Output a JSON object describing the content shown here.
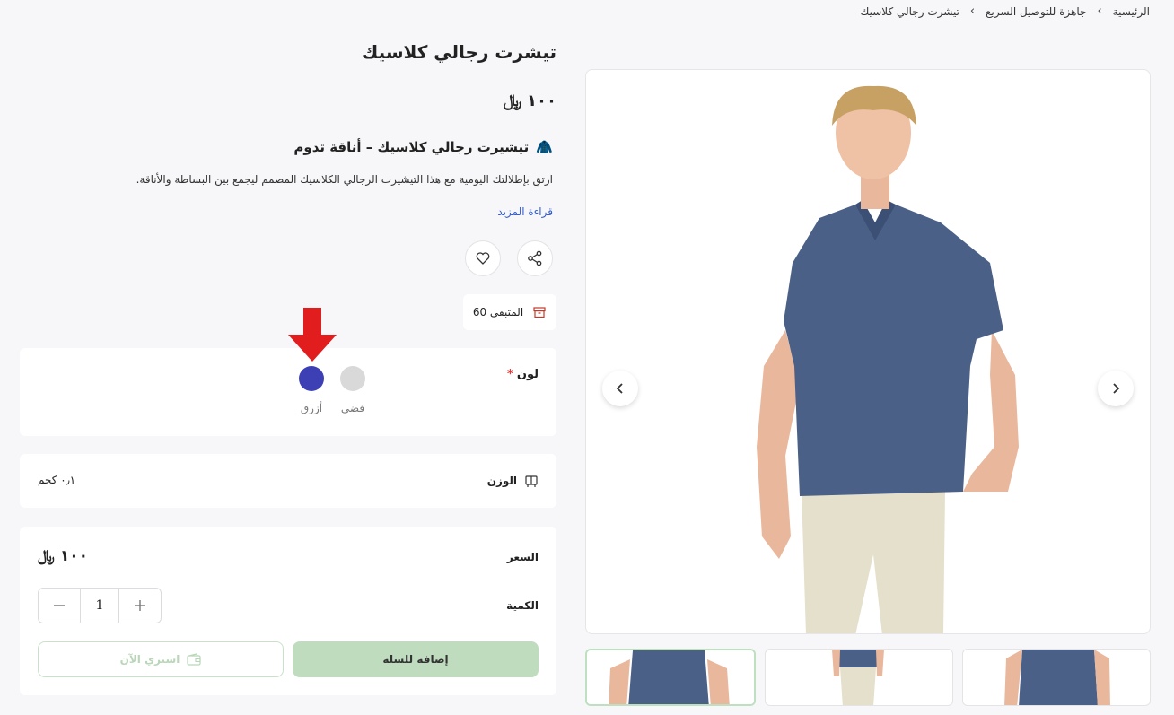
{
  "breadcrumb": {
    "items": [
      "الرئيسية",
      "جاهزة للتوصيل السريع",
      "تيشرت رجالي كلاسيك"
    ],
    "separator": "›"
  },
  "product": {
    "title": "تيشرت رجالي كلاسيك",
    "price": "١٠٠",
    "currency_symbol": "﷼",
    "description_heading": "تيشيرت رجالي كلاسيك – أناقة تدوم",
    "description_emoji": "🧥",
    "description_text": "ارتقِ بإطلالتك اليومية مع هذا التيشيرت الرجالي الكلاسيك المصمم ليجمع بين البساطة والأناقة.",
    "read_more": "قراءة المزيد",
    "stock_text": "المتبقي 60"
  },
  "color_option": {
    "label": "لون",
    "required_mark": "*",
    "swatches": [
      {
        "name": "فضي",
        "color": "#d9d9d9"
      },
      {
        "name": "أزرق",
        "color": "#3d3fb5"
      }
    ]
  },
  "weight": {
    "label": "الوزن",
    "value": "٠٫١ كجم"
  },
  "purchase": {
    "price_label": "السعر",
    "price_value": "١٠٠",
    "quantity_label": "الكمية",
    "quantity": "1",
    "add_to_cart": "إضافة للسلة",
    "buy_now": "اشتري الآن"
  },
  "icons": {
    "share": "share-icon",
    "wishlist": "heart-icon",
    "stock": "box-icon",
    "weight": "scale-icon",
    "wallet": "wallet-icon",
    "prev": "chevron-left-icon",
    "next": "chevron-right-icon"
  },
  "colors": {
    "accent_green": "#bfdcbf",
    "link_blue": "#2f5bd3",
    "annotation_red": "#e11d1d"
  }
}
